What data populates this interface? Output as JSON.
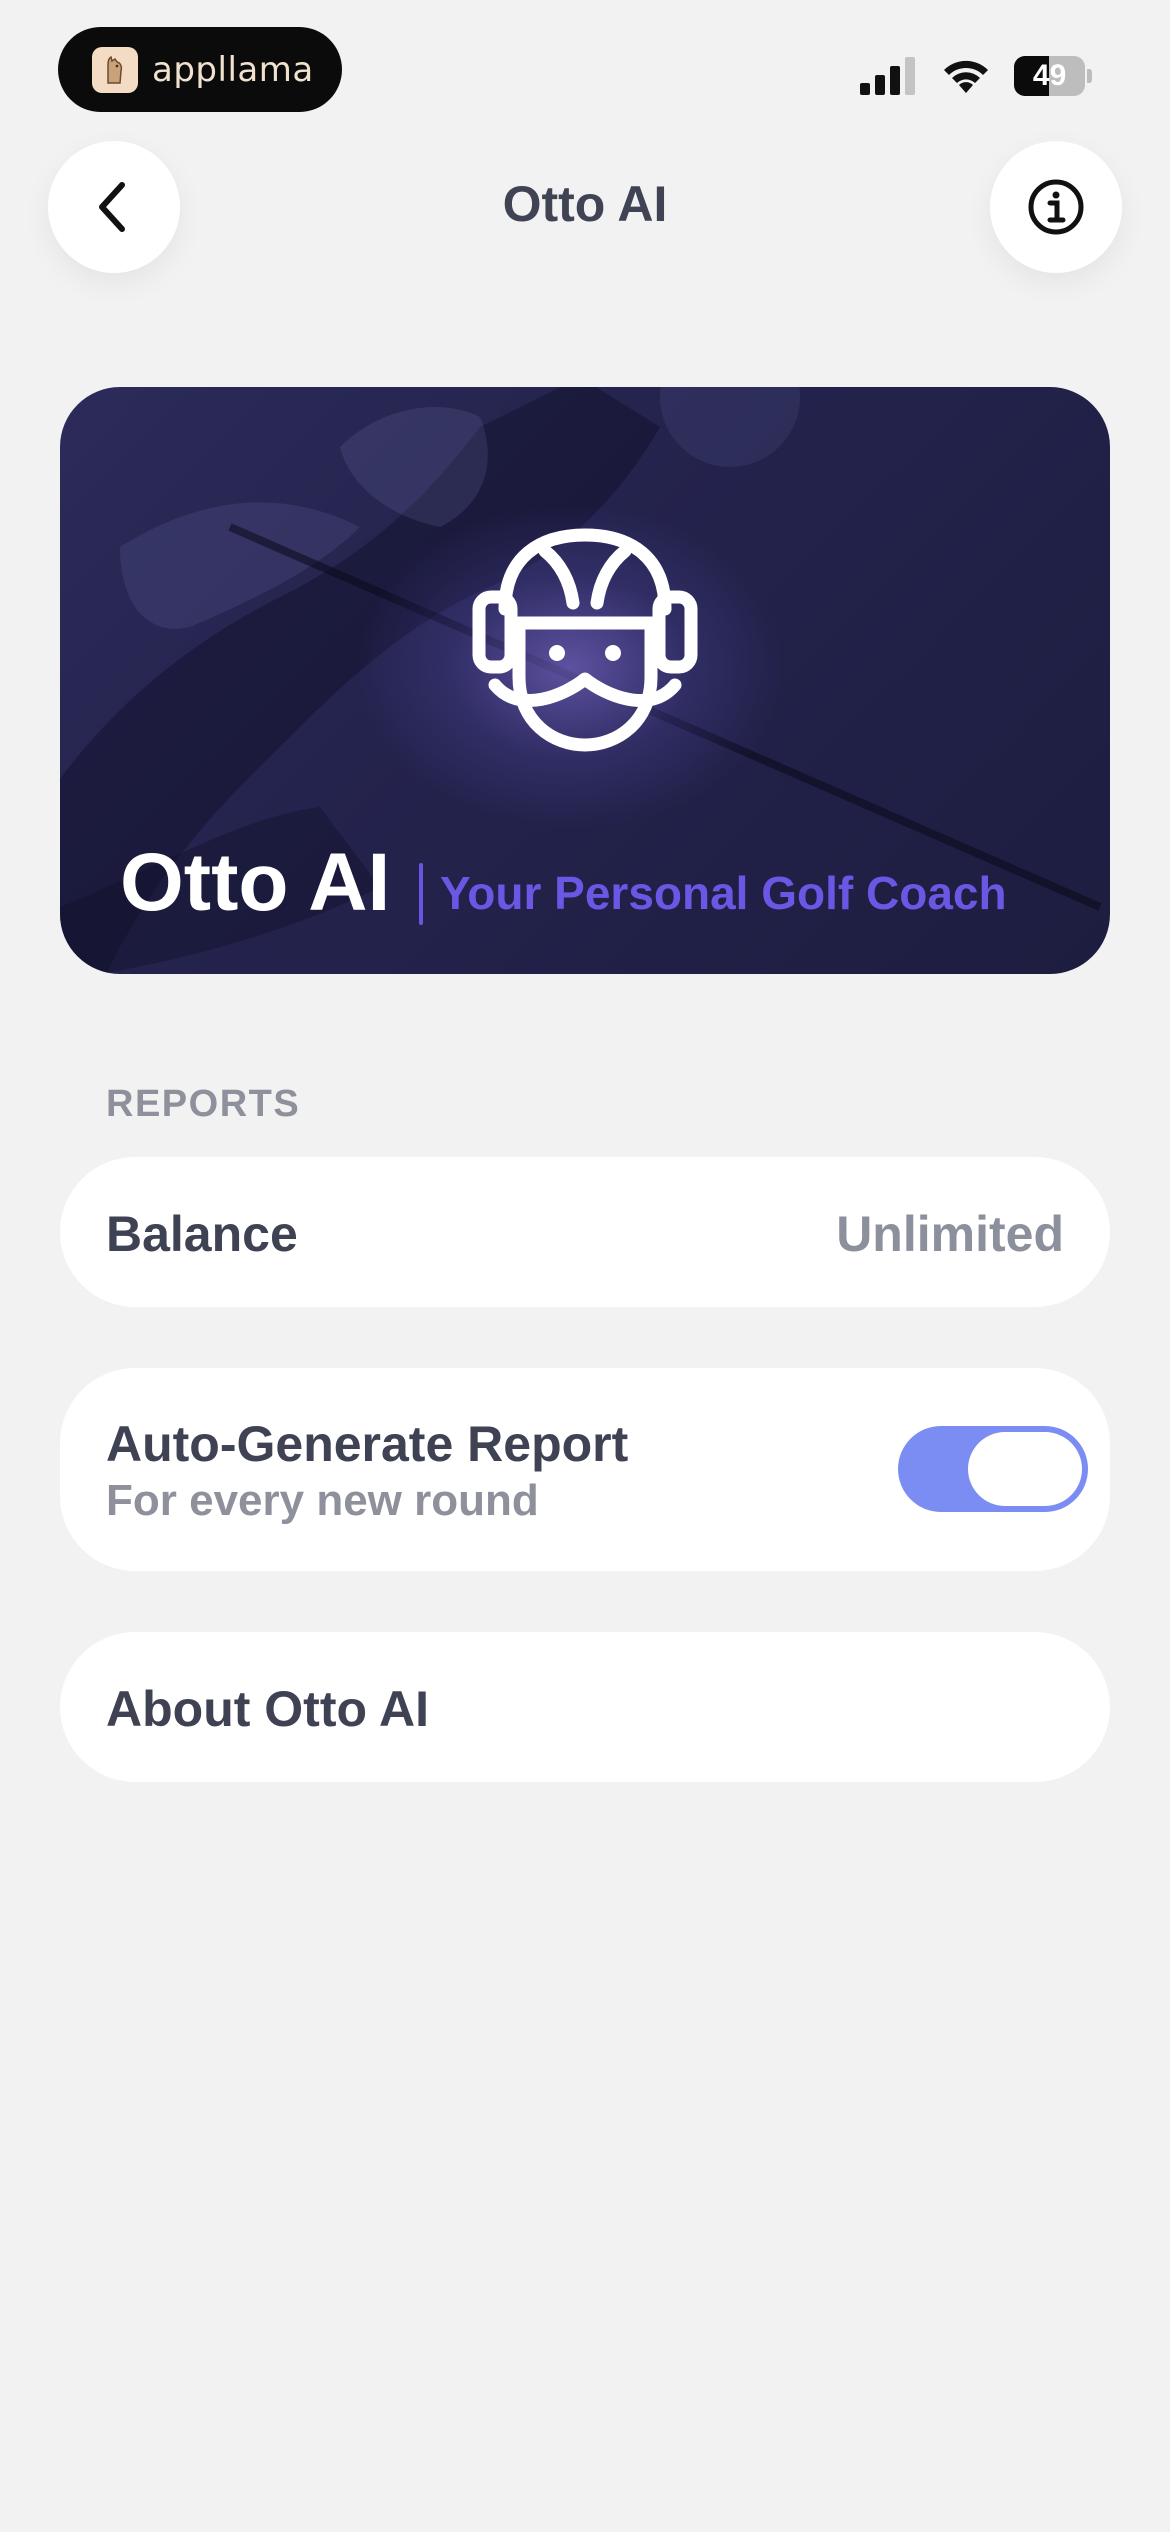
{
  "status_bar": {
    "brand": "appllama",
    "battery_level": "49",
    "battery_fraction": 0.49
  },
  "nav": {
    "title": "Otto AI",
    "back_icon": "chevron-left-icon",
    "info_icon": "info-circle-icon"
  },
  "hero": {
    "title": "Otto AI",
    "subtitle": "Your Personal Golf Coach",
    "icon": "otto-coach-face-icon",
    "accent_color": "#6c56e4"
  },
  "reports": {
    "section_label": "REPORTS",
    "balance": {
      "label": "Balance",
      "value": "Unlimited"
    },
    "auto_generate": {
      "label": "Auto-Generate Report",
      "sublabel": "For every new round",
      "enabled": true,
      "toggle_color": "#7b8cf2"
    },
    "about": {
      "label": "About Otto AI"
    }
  }
}
